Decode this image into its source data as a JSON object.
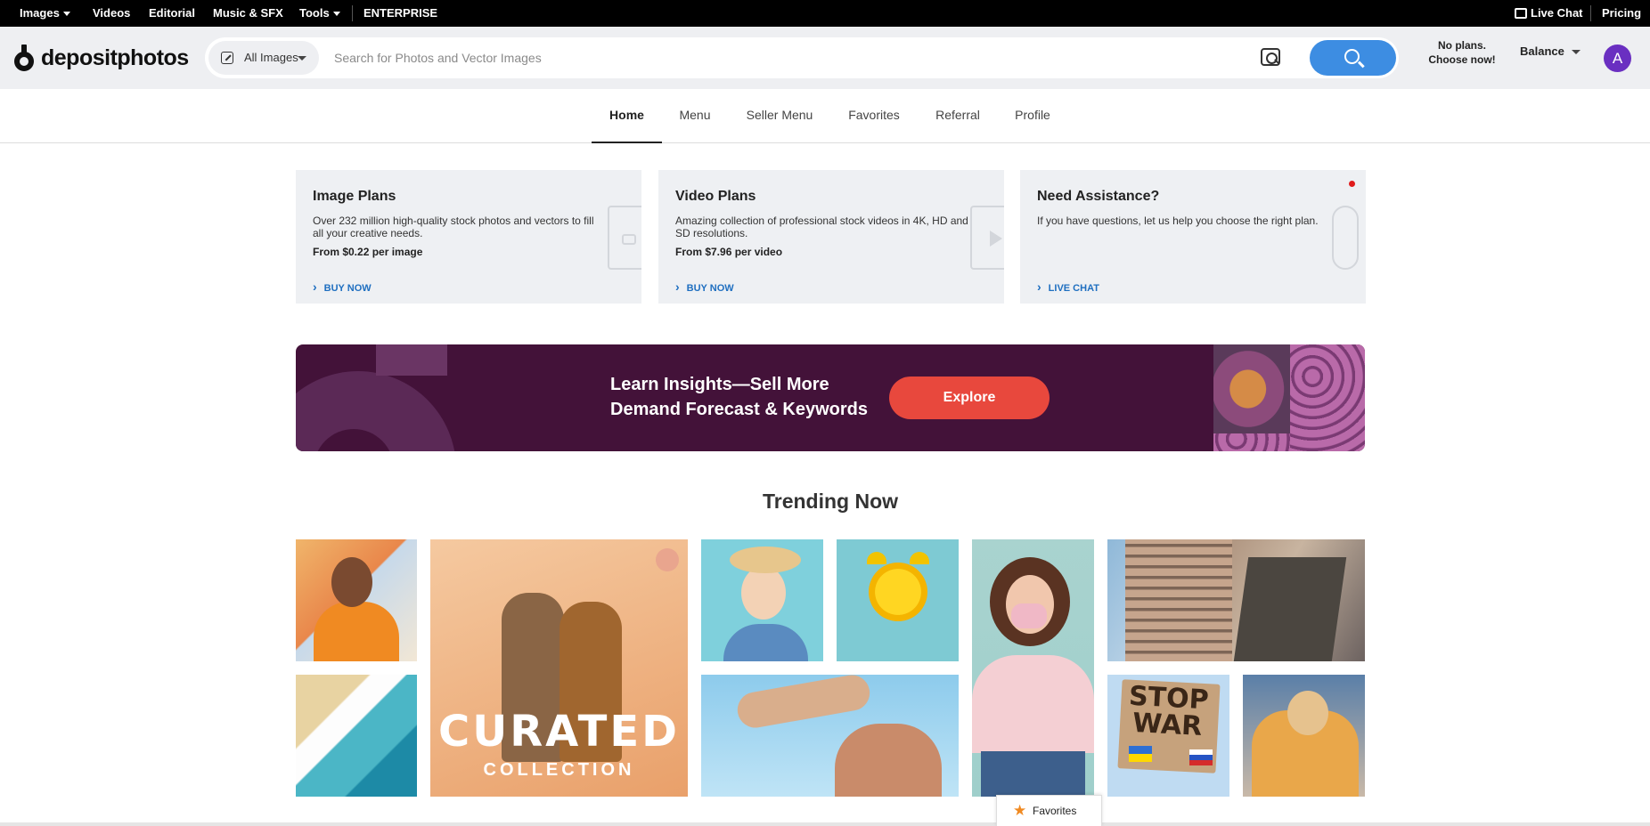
{
  "topbar": {
    "images_label": "Images",
    "videos_label": "Videos",
    "editorial_label": "Editorial",
    "music_label": "Music & SFX",
    "tools_label": "Tools",
    "enterprise_label": "ENTERPRISE",
    "live_chat_label": "Live Chat",
    "pricing_label": "Pricing"
  },
  "header": {
    "logo_text": "depositphotos",
    "scope_label": "All Images",
    "search_placeholder": "Search for Photos and Vector Images",
    "plans_line1": "No plans.",
    "plans_line2": "Choose now!",
    "balance_label": "Balance",
    "avatar_letter": "A"
  },
  "nav": {
    "tabs": [
      {
        "label": "Home",
        "active": true
      },
      {
        "label": "Menu"
      },
      {
        "label": "Seller Menu"
      },
      {
        "label": "Favorites"
      },
      {
        "label": "Referral"
      },
      {
        "label": "Profile"
      }
    ]
  },
  "cards": [
    {
      "title": "Image Plans",
      "description": "Over 232 million high-quality stock photos and vectors to fill all your creative needs.",
      "price": "From $0.22 per image",
      "cta": "BUY NOW",
      "icon": "image-frame-icon"
    },
    {
      "title": "Video Plans",
      "description": "Amazing collection of professional stock videos in 4K, HD and SD resolutions.",
      "price": "From $7.96 per video",
      "cta": "BUY NOW",
      "icon": "film-icon"
    },
    {
      "title": "Need Assistance?",
      "description": "If you have questions, let us help you choose the right plan.",
      "price": "",
      "cta": "LIVE CHAT",
      "icon": "phone-icon"
    }
  ],
  "banner": {
    "line1": "Learn Insights—Sell More",
    "line2": "Demand Forecast & Keywords",
    "button_label": "Explore"
  },
  "trending": {
    "title": "Trending Now",
    "curated_line1": "CURATED",
    "curated_line2": "COLLECTION",
    "sign_text": "STOP WAR"
  },
  "favorites_button": {
    "label": "Favorites"
  },
  "colors": {
    "accent_blue": "#3d8de2",
    "banner_bg": "#431239",
    "explore_red": "#e8483d",
    "avatar_purple": "#6a2fc1",
    "link_blue": "#1f6fc0"
  }
}
